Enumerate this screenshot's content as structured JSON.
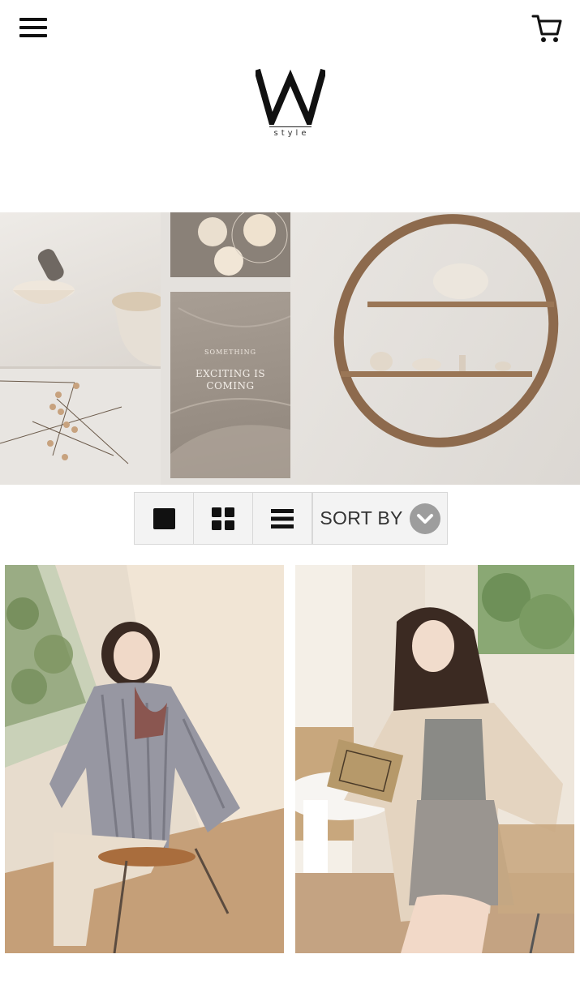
{
  "header": {
    "menu_icon": "hamburger-menu-icon",
    "cart_icon": "shopping-cart-icon",
    "logo": {
      "mark": "W",
      "subtitle": "style"
    }
  },
  "banner": {
    "card_small": "SOMETHING",
    "card_line1": "EXCITING IS",
    "card_line2": "COMING"
  },
  "toolbar": {
    "views": [
      {
        "icon": "single-view-icon",
        "label": ""
      },
      {
        "icon": "grid-view-icon",
        "label": ""
      },
      {
        "icon": "list-view-icon",
        "label": ""
      }
    ],
    "sort_label": "SORT BY",
    "sort_icon": "chevron-down-circle-icon"
  },
  "products": [
    {
      "image": "model in striped shirt seated by window"
    },
    {
      "image": "model in beige cardigan holding book"
    }
  ],
  "colors": {
    "sort_chevron": "#9d9d9d",
    "toolbar_bg": "#f3f3f3",
    "banner_bg": "#e4e1dd"
  }
}
